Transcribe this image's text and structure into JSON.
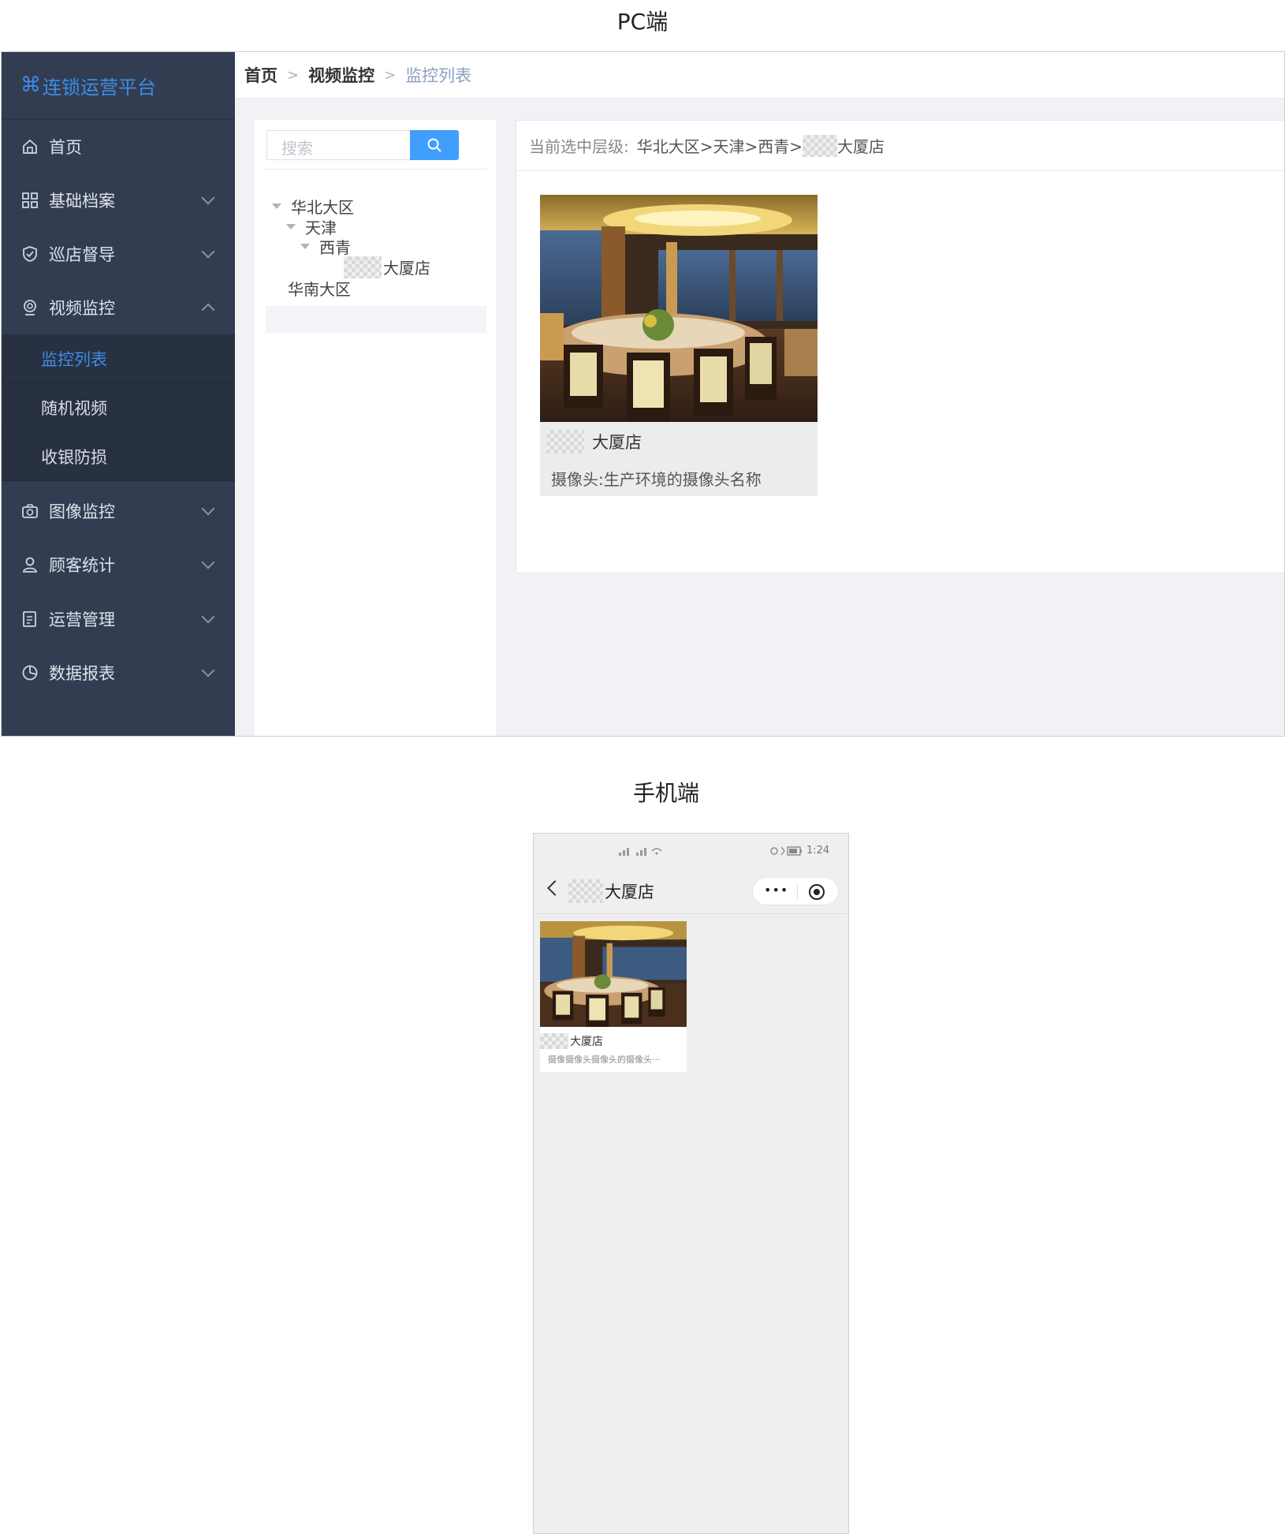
{
  "captions": {
    "pc": "PC端",
    "mobile": "手机端"
  },
  "app": {
    "title": "连锁运营平台"
  },
  "sidebar": {
    "items": [
      {
        "label": "首页",
        "icon": "home-icon"
      },
      {
        "label": "基础档案",
        "icon": "grid-icon"
      },
      {
        "label": "巡店督导",
        "icon": "shield-icon"
      },
      {
        "label": "视频监控",
        "icon": "camera-icon",
        "expanded": true,
        "children": [
          {
            "label": "监控列表",
            "active": true
          },
          {
            "label": "随机视频"
          },
          {
            "label": "收银防损"
          }
        ]
      },
      {
        "label": "图像监控",
        "icon": "photo-camera-icon"
      },
      {
        "label": "顾客统计",
        "icon": "user-icon"
      },
      {
        "label": "运营管理",
        "icon": "clipboard-icon"
      },
      {
        "label": "数据报表",
        "icon": "pie-chart-icon"
      }
    ]
  },
  "breadcrumb": {
    "items": [
      "首页",
      "视频监控",
      "监控列表"
    ],
    "separator": ">"
  },
  "tree": {
    "search_placeholder": "搜索",
    "nodes": {
      "n1": "华北大区",
      "n2": "天津",
      "n3": "西青",
      "n4": "大厦店",
      "n5": "华南大区"
    }
  },
  "content": {
    "path_label": "当前选中层级:",
    "path_value_prefix": "华北大区>天津>西青>",
    "path_value_suffix": "大厦店",
    "card": {
      "store": "大厦店",
      "camera": "摄像头:生产环境的摄像头名称"
    }
  },
  "mobile": {
    "status_left": "\"\"\"",
    "status_time": "1:24",
    "nav_title": "大厦店",
    "capsule_more": "•••",
    "card": {
      "store": "大厦店",
      "desc": "摄像摄像头摄像头的摄像头···"
    }
  },
  "colors": {
    "sidebar": "#333d52",
    "accent": "#409eff",
    "active_sub": "#3a8ee6"
  }
}
